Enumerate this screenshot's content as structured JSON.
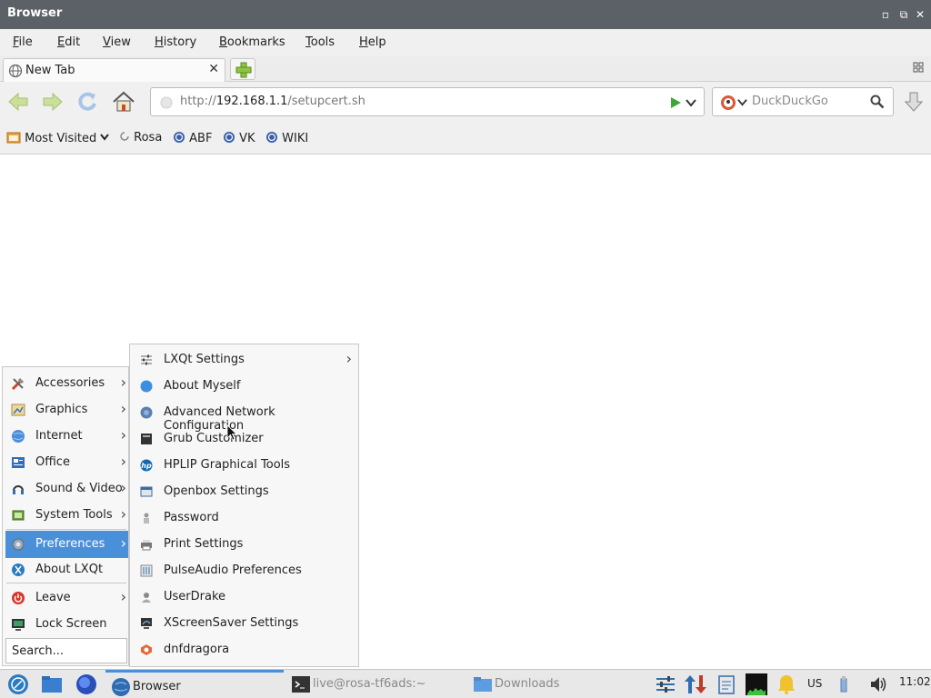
{
  "window": {
    "title": "Browser"
  },
  "menubar": {
    "items": [
      "File",
      "Edit",
      "View",
      "History",
      "Bookmarks",
      "Tools",
      "Help"
    ],
    "underline": [
      "F",
      "E",
      "V",
      "H",
      "B",
      "T",
      "H"
    ]
  },
  "tabs": [
    {
      "label": "New Tab"
    }
  ],
  "navbar": {
    "url_prefix": "http://",
    "url_host": "192.168.1.1",
    "url_path": "/setupcert.sh",
    "search_engine": "DuckDuckGo"
  },
  "bookmarks": [
    "Most Visited",
    "Rosa",
    "ABF",
    "VK",
    "WIKI"
  ],
  "start_menu": {
    "items": [
      {
        "label": "Accessories",
        "icon": "accessories-icon",
        "sub": true
      },
      {
        "label": "Graphics",
        "icon": "graphics-icon",
        "sub": true
      },
      {
        "label": "Internet",
        "icon": "internet-icon",
        "sub": true
      },
      {
        "label": "Office",
        "icon": "office-icon",
        "sub": true
      },
      {
        "label": "Sound & Video",
        "icon": "sound-video-icon",
        "sub": true
      },
      {
        "label": "System Tools",
        "icon": "system-tools-icon",
        "sub": true
      },
      {
        "label": "Preferences",
        "icon": "preferences-icon",
        "sub": true
      },
      {
        "label": "About LXQt",
        "icon": "lxqt-icon",
        "sub": false
      },
      {
        "label": "Leave",
        "icon": "power-icon",
        "sub": true
      },
      {
        "label": "Lock Screen",
        "icon": "lock-screen-icon",
        "sub": false
      }
    ],
    "search_placeholder": "Search..."
  },
  "preferences_submenu": {
    "items": [
      "LXQt Settings",
      "About Myself",
      "Advanced Network Configuration",
      "Grub Customizer",
      "HPLIP Graphical Tools",
      "Openbox Settings",
      "Password",
      "Print Settings",
      "PulseAudio Preferences",
      "UserDrake",
      "XScreenSaver Settings",
      "dnfdragora"
    ]
  },
  "taskbar": {
    "tasks": [
      "Browser",
      "live@rosa-tf6ads:~",
      "Downloads"
    ],
    "keyboard_layout": "US",
    "clock": "11:02"
  },
  "colors": {
    "accent": "#4a90d9",
    "titlebar": "#5c6168"
  }
}
